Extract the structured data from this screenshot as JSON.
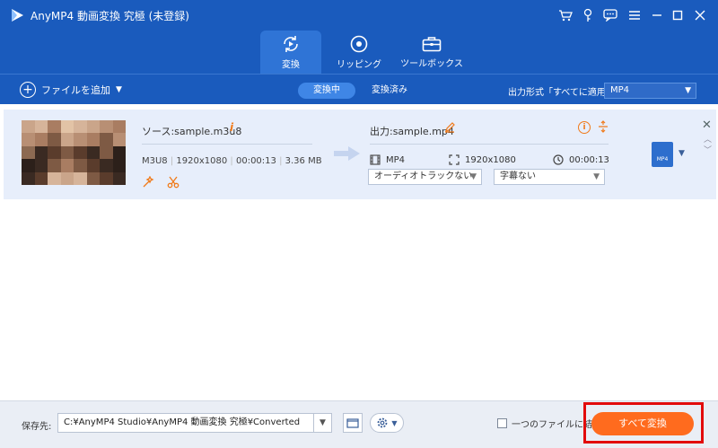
{
  "window": {
    "title": "AnyMP4 動画変換 究極 (未登録)"
  },
  "nav": {
    "tabs": [
      {
        "label": "変換"
      },
      {
        "label": "リッピング"
      },
      {
        "label": "ツールボックス"
      }
    ]
  },
  "toolbar": {
    "add_file": "ファイルを追加",
    "tab_converting": "変換中",
    "tab_converted": "変換済み",
    "output_format_label": "出力形式「すべてに適用」:",
    "output_format_value": "MP4"
  },
  "file": {
    "source_name": "ソース:sample.m3u8",
    "src_format": "M3U8",
    "src_resolution": "1920x1080",
    "src_duration": "00:00:13",
    "src_size": "3.36 MB",
    "output_name": "出力:sample.mp4",
    "out_format": "MP4",
    "out_resolution": "1920x1080",
    "out_duration": "00:00:13",
    "audio_track": "オーディオトラックない",
    "subtitle": "字幕ない",
    "badge": "MP4"
  },
  "bottom": {
    "save_label": "保存先:",
    "save_path": "C:¥AnyMP4 Studio¥AnyMP4 動画変換 究極¥Converted",
    "merge_label": "一つのファイルに結合",
    "convert_all": "すべて変換"
  },
  "colors": {
    "header": "#1a5bbd",
    "accent": "#ff6b1e",
    "highlight": "#e20b0b"
  }
}
